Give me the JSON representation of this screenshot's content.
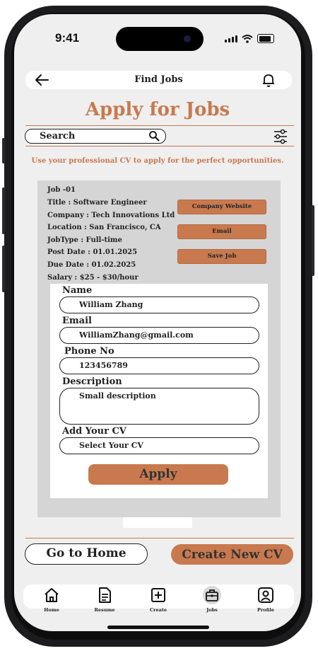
{
  "status_bar": {
    "time": "9:41"
  },
  "header": {
    "title": "Find Jobs"
  },
  "page": {
    "heading": "Apply for Jobs",
    "tagline": "Use your professional CV to apply for the perfect opportunities."
  },
  "search": {
    "label": "Search"
  },
  "job": {
    "id": "Job -01",
    "title": "Title : Software Engineer",
    "company": "Company : Tech Innovations Ltd",
    "location": "Location : San Francisco, CA",
    "type": "JobType : Full-time",
    "post_date": "Post Date : 01.01.2025",
    "due_date": "Due Date : 01.02.2025",
    "salary": "Salary : $25 - $30/hour",
    "buttons": {
      "website": "Company Website",
      "email": "Email",
      "save": "Save Job"
    }
  },
  "form": {
    "name_label": "Name",
    "name_value": "William Zhang",
    "email_label": "Email",
    "email_value": "WilliamZhang@gmail.com",
    "phone_label": "Phone No",
    "phone_value": "123456789",
    "desc_label": "Description",
    "desc_value": "Small description",
    "cv_label": "Add Your CV",
    "cv_value": "Select Your CV",
    "apply_label": "Apply"
  },
  "actions": {
    "home": "Go to Home",
    "create_cv": "Create New CV"
  },
  "nav": {
    "items": [
      {
        "label": "Home",
        "icon": "home-icon"
      },
      {
        "label": "Resume",
        "icon": "document-icon"
      },
      {
        "label": "Create",
        "icon": "plus-square-icon"
      },
      {
        "label": "Jobs",
        "icon": "briefcase-icon",
        "active": true
      },
      {
        "label": "Profile",
        "icon": "user-icon"
      }
    ]
  },
  "colors": {
    "accent": "#c8794e",
    "card": "#d5d5d5",
    "background": "#efefef"
  }
}
